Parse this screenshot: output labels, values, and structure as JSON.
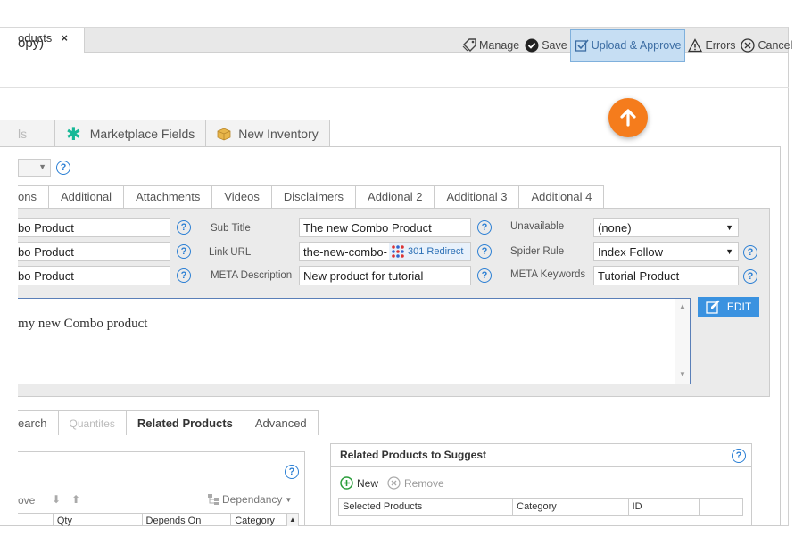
{
  "doc_tab": {
    "label": "oducts",
    "close": "×"
  },
  "page_title": "opy)",
  "toolbar": {
    "manage": "Manage",
    "save": "Save",
    "upload_approve": "Upload & Approve",
    "errors": "Errors",
    "cancel": "Cancel"
  },
  "section_tabs": [
    {
      "label": "ls"
    },
    {
      "label": "Marketplace Fields"
    },
    {
      "label": "New Inventory"
    }
  ],
  "detail_tabs": [
    "ons",
    "Additional",
    "Attachments",
    "Videos",
    "Disclaimers",
    "Addional 2",
    "Additional 3",
    "Additional 4"
  ],
  "fields": {
    "name1": "bo Product",
    "name2": "bo Product",
    "name3": "bo Product",
    "sub_title_label": "Sub Title",
    "sub_title_value": "The new Combo Product",
    "link_url_label": "Link URL",
    "link_url_value": "the-new-combo-",
    "redirect_label": "301 Redirect",
    "meta_desc_label": "META Description",
    "meta_desc_value": "New product for tutorial",
    "unavailable_label": "Unavailable",
    "unavailable_value": "(none)",
    "spider_label": "Spider Rule",
    "spider_value": "Index Follow",
    "meta_kw_label": "META Keywords",
    "meta_kw_value": "Tutorial Product"
  },
  "description_text": "my new Combo product",
  "edit_button": "EDIT",
  "bottom_tabs": [
    "earch",
    "Quantites",
    "Related Products",
    "Advanced"
  ],
  "left_panel": {
    "move": "ove",
    "dependancy": "Dependancy",
    "columns": [
      "Qty",
      "Depends On",
      "Category"
    ]
  },
  "right_panel": {
    "title": "Related Products to Suggest",
    "new": "New",
    "remove": "Remove",
    "columns": [
      "Selected Products",
      "Category",
      "ID"
    ]
  },
  "colors": {
    "accent": "#3a92e0",
    "highlight": "#c6def3",
    "orange": "#f57c1c"
  }
}
